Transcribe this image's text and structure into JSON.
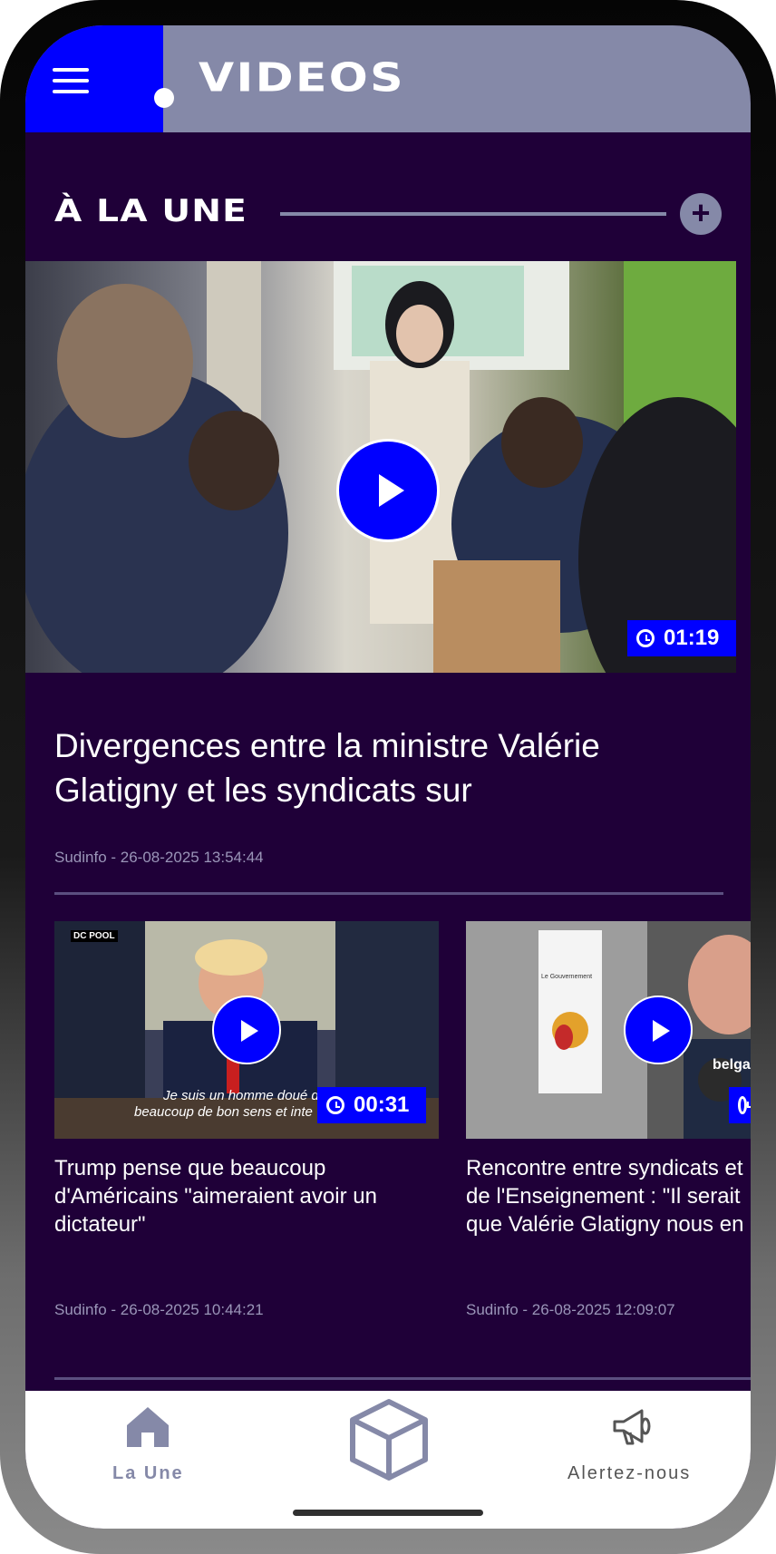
{
  "header": {
    "title": "VIDEOS",
    "menu_icon": "hamburger-menu-icon",
    "accent_color": "#0000ff",
    "header_color": "#8589a8"
  },
  "section": {
    "title": "À LA UNE",
    "more_icon": "plus-icon"
  },
  "hero": {
    "duration": "01:19",
    "title": "Divergences entre la ministre Valérie Glatigny et les syndicats sur",
    "meta": "Sudinfo - 26-08-2025 13:54:44"
  },
  "cards": [
    {
      "duration": "00:31",
      "title": "Trump pense que beaucoup d'Américains \"aimeraient avoir un dictateur\"",
      "meta": "Sudinfo - 26-08-2025 10:44:21",
      "overlay_caption_1": "Je suis un homme doué d",
      "overlay_caption_2": "beaucoup de bon sens et inte",
      "corner_label": "DC POOL"
    },
    {
      "title": "Rencontre entre syndicats et de l'Enseignement : \"Il serait que Valérie Glatigny nous en",
      "meta": "Sudinfo - 26-08-2025 12:09:07",
      "sign_text": "Le Gouvernement",
      "logo_text": "belga"
    }
  ],
  "bottom_nav": {
    "home_label": "La Une",
    "alert_label": "Alertez-nous",
    "home_icon": "home-icon",
    "cube_icon": "cube-icon",
    "megaphone_icon": "megaphone-icon"
  }
}
